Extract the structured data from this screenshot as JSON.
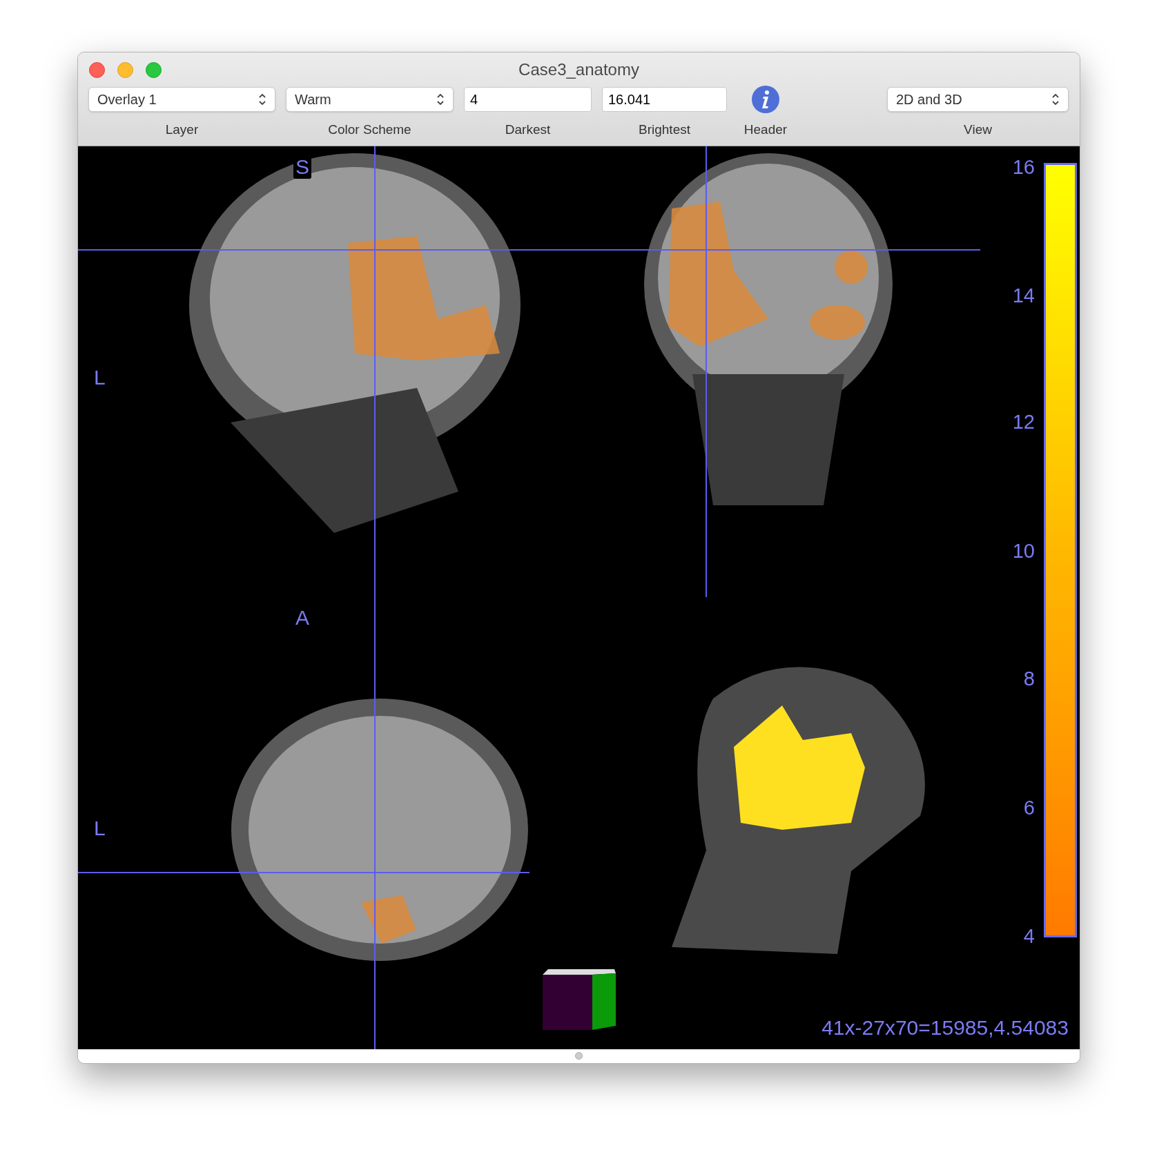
{
  "window": {
    "title": "Case3_anatomy"
  },
  "toolbar": {
    "layer": {
      "label": "Layer",
      "value": "Overlay 1"
    },
    "color_scheme": {
      "label": "Color Scheme",
      "value": "Warm"
    },
    "darkest": {
      "label": "Darkest",
      "value": "4"
    },
    "brightest": {
      "label": "Brightest",
      "value": "16.041"
    },
    "header": {
      "label": "Header"
    },
    "view": {
      "label": "View",
      "value": "2D and 3D"
    }
  },
  "viewer": {
    "orientation_labels": [
      {
        "text": "S"
      },
      {
        "text": "L"
      },
      {
        "text": "A"
      },
      {
        "text": "L"
      }
    ],
    "colorbar": {
      "ticks": [
        "16",
        "14",
        "12",
        "10",
        "8",
        "6",
        "4"
      ]
    },
    "readout": "41x-27x70=15985,4.54083"
  }
}
